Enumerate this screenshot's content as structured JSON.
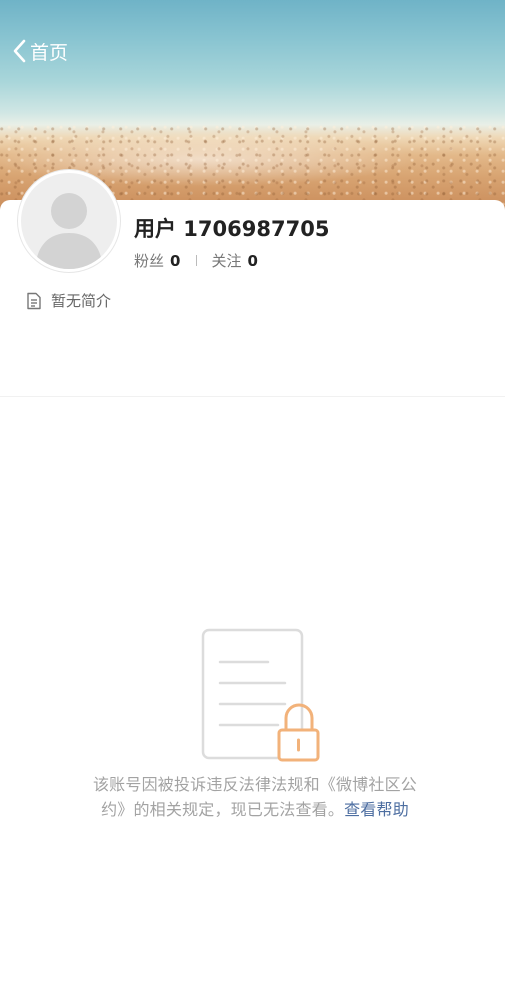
{
  "header": {
    "back_label": "首页"
  },
  "profile": {
    "username": "用户 1706987705",
    "fans_label": "粉丝",
    "fans_count": "0",
    "follow_label": "关注",
    "follow_count": "0",
    "bio": "暂无简介"
  },
  "notice": {
    "message_line1": "该账号因被投诉违反法律法规和《微博社区公",
    "message_line2": "约》的相关规定，现已无法查看。",
    "help_link": "查看帮助"
  },
  "colors": {
    "link": "#4d6ea1",
    "lock_accent": "#f2b27a",
    "muted_text": "#a3a3a3"
  },
  "icons": [
    "back-chevron-icon",
    "default-avatar-icon",
    "document-icon",
    "locked-document-icon"
  ]
}
